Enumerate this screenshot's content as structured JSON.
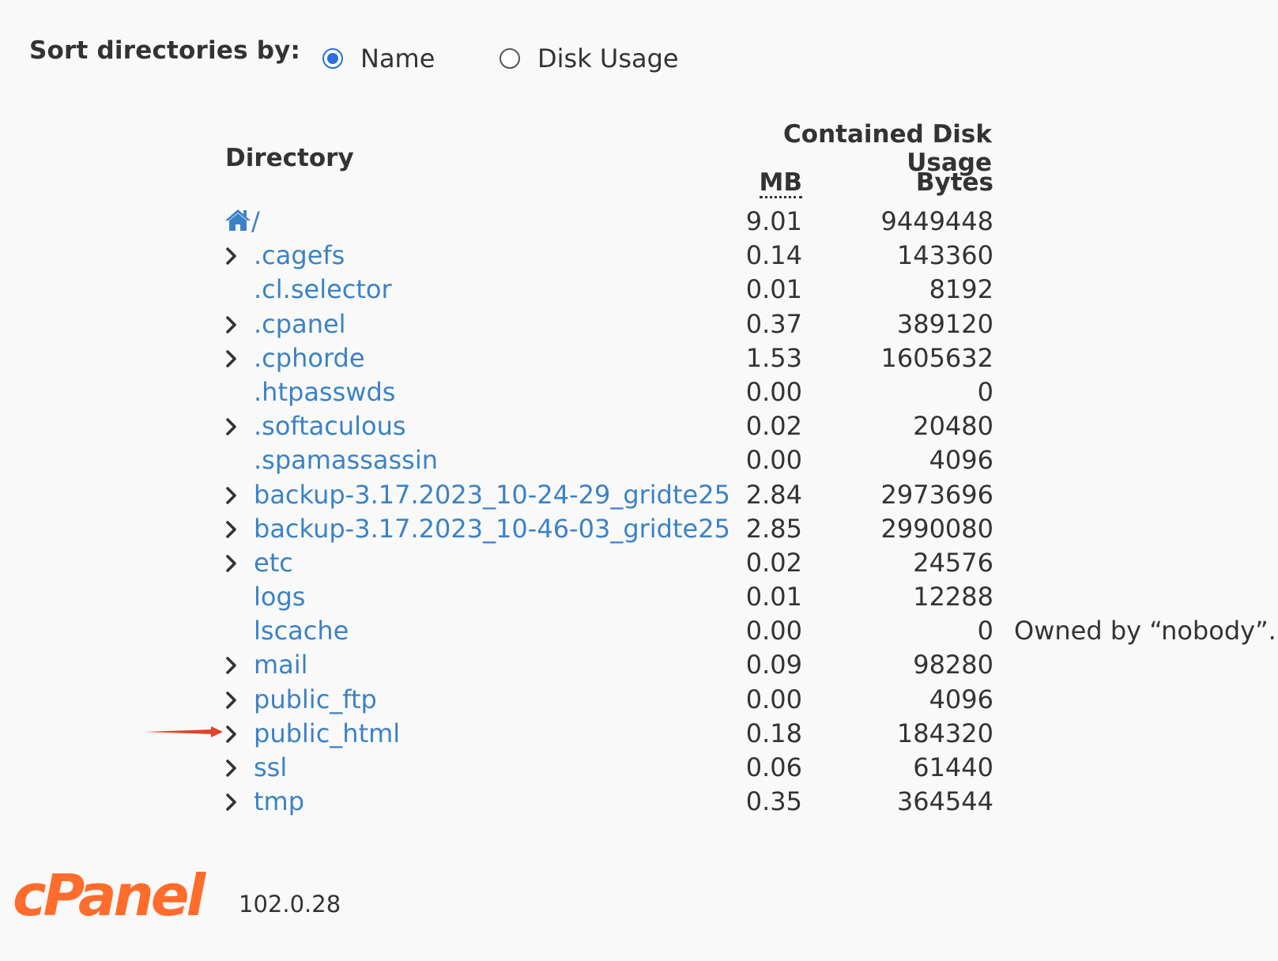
{
  "sort": {
    "label": "Sort directories by:",
    "options": [
      {
        "label": "Name",
        "selected": true
      },
      {
        "label": "Disk Usage",
        "selected": false
      }
    ]
  },
  "table": {
    "header_contained": "Contained Disk Usage",
    "header_directory": "Directory",
    "header_mb": "MB",
    "header_bytes": "Bytes",
    "rows": [
      {
        "name": "/",
        "mb": "9.01",
        "bytes": "9449448",
        "expandable": false,
        "icon": "home-icon",
        "note": ""
      },
      {
        "name": ".cagefs",
        "mb": "0.14",
        "bytes": "143360",
        "expandable": true,
        "note": ""
      },
      {
        "name": ".cl.selector",
        "mb": "0.01",
        "bytes": "8192",
        "expandable": false,
        "note": ""
      },
      {
        "name": ".cpanel",
        "mb": "0.37",
        "bytes": "389120",
        "expandable": true,
        "note": ""
      },
      {
        "name": ".cphorde",
        "mb": "1.53",
        "bytes": "1605632",
        "expandable": true,
        "note": ""
      },
      {
        "name": ".htpasswds",
        "mb": "0.00",
        "bytes": "0",
        "expandable": false,
        "note": ""
      },
      {
        "name": ".softaculous",
        "mb": "0.02",
        "bytes": "20480",
        "expandable": true,
        "note": ""
      },
      {
        "name": ".spamassassin",
        "mb": "0.00",
        "bytes": "4096",
        "expandable": false,
        "note": ""
      },
      {
        "name": "backup-3.17.2023_10-24-29_gridte25",
        "mb": "2.84",
        "bytes": "2973696",
        "expandable": true,
        "note": ""
      },
      {
        "name": "backup-3.17.2023_10-46-03_gridte25",
        "mb": "2.85",
        "bytes": "2990080",
        "expandable": true,
        "note": ""
      },
      {
        "name": "etc",
        "mb": "0.02",
        "bytes": "24576",
        "expandable": true,
        "note": ""
      },
      {
        "name": "logs",
        "mb": "0.01",
        "bytes": "12288",
        "expandable": false,
        "note": ""
      },
      {
        "name": "lscache",
        "mb": "0.00",
        "bytes": "0",
        "expandable": false,
        "note": "Owned by “nobody”."
      },
      {
        "name": "mail",
        "mb": "0.09",
        "bytes": "98280",
        "expandable": true,
        "note": ""
      },
      {
        "name": "public_ftp",
        "mb": "0.00",
        "bytes": "4096",
        "expandable": true,
        "note": ""
      },
      {
        "name": "public_html",
        "mb": "0.18",
        "bytes": "184320",
        "expandable": true,
        "note": "",
        "annotated": true
      },
      {
        "name": "ssl",
        "mb": "0.06",
        "bytes": "61440",
        "expandable": true,
        "note": ""
      },
      {
        "name": "tmp",
        "mb": "0.35",
        "bytes": "364544",
        "expandable": true,
        "note": ""
      }
    ]
  },
  "footer": {
    "logo_text": "cPanel",
    "version": "102.0.28"
  },
  "colors": {
    "link": "#3b82c6",
    "radio_selected": "#2a6fdb",
    "logo": "#ff6c2c",
    "annotation_arrow": "#e0442e"
  }
}
